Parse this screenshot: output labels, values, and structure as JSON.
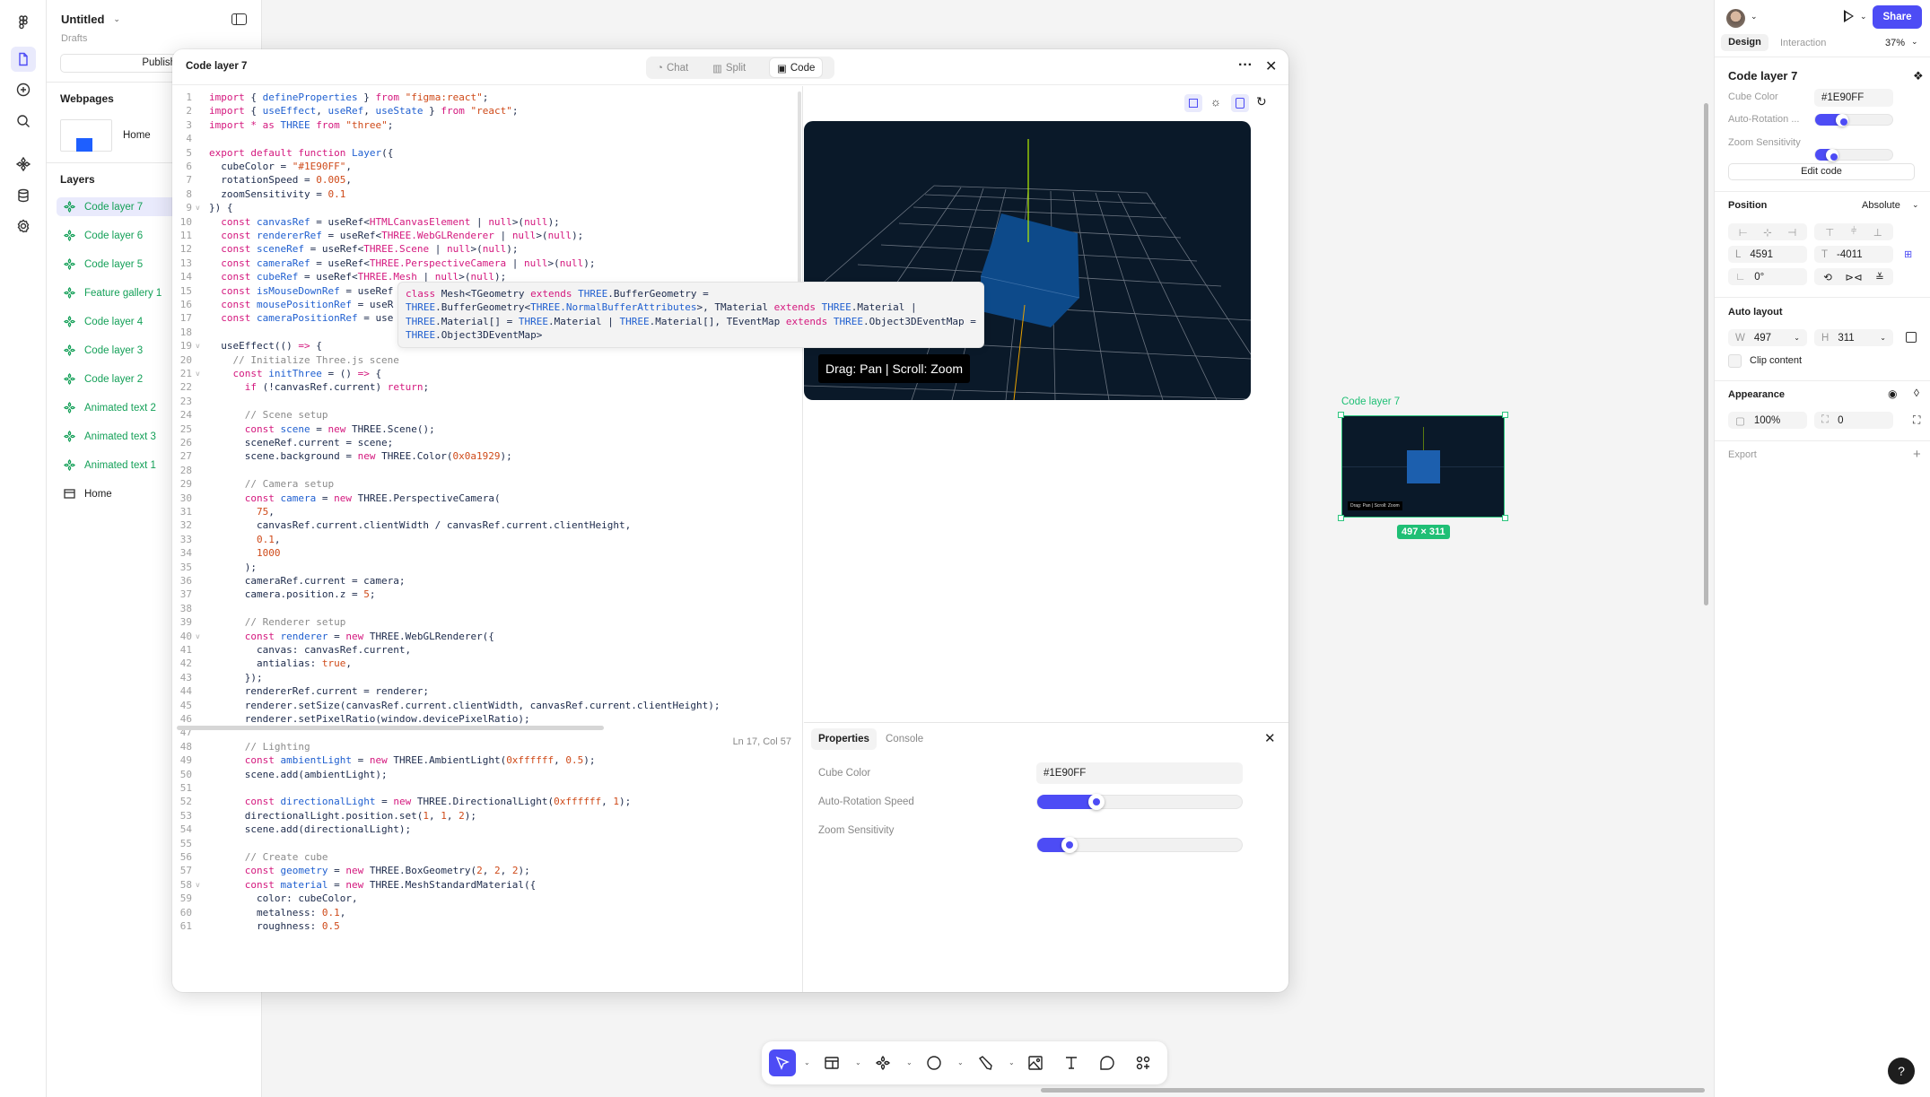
{
  "left_panel": {
    "file_title": "Untitled",
    "location": "Drafts",
    "publish_label": "Publish...",
    "webpages_heading": "Webpages",
    "webpages": [
      {
        "label": "Home"
      }
    ],
    "layers_heading": "Layers",
    "layers": [
      {
        "label": "Code layer 7",
        "selected": true
      },
      {
        "label": "Code layer 6"
      },
      {
        "label": "Code layer 5"
      },
      {
        "label": "Feature gallery 1"
      },
      {
        "label": "Code layer 4"
      },
      {
        "label": "Code layer 3"
      },
      {
        "label": "Code layer 2"
      },
      {
        "label": "Animated text 2"
      },
      {
        "label": "Animated text 3"
      },
      {
        "label": "Animated text 1"
      },
      {
        "label": "Home",
        "type": "page"
      }
    ]
  },
  "modal": {
    "title": "Code layer 7",
    "tabs": [
      {
        "label": "Chat"
      },
      {
        "label": "Split"
      },
      {
        "label": "Code",
        "active": true
      }
    ],
    "status": "Ln 17, Col 57",
    "folded_lines": [
      9,
      19,
      21,
      40,
      58
    ],
    "code_lines": [
      [
        [
          "k",
          "import"
        ],
        [
          "p",
          " { "
        ],
        [
          "v",
          "defineProperties"
        ],
        [
          "p",
          " } "
        ],
        [
          "k",
          "from"
        ],
        [
          "p",
          " "
        ],
        [
          "s",
          "\"figma:react\""
        ],
        [
          "p",
          ";"
        ]
      ],
      [
        [
          "k",
          "import"
        ],
        [
          "p",
          " { "
        ],
        [
          "v",
          "useEffect"
        ],
        [
          "p",
          ", "
        ],
        [
          "v",
          "useRef"
        ],
        [
          "p",
          ", "
        ],
        [
          "v",
          "useState"
        ],
        [
          "p",
          " } "
        ],
        [
          "k",
          "from"
        ],
        [
          "p",
          " "
        ],
        [
          "s",
          "\"react\""
        ],
        [
          "p",
          ";"
        ]
      ],
      [
        [
          "k",
          "import"
        ],
        [
          "p",
          " "
        ],
        [
          "k",
          "*"
        ],
        [
          "p",
          " "
        ],
        [
          "k",
          "as"
        ],
        [
          "p",
          " "
        ],
        [
          "v",
          "THREE"
        ],
        [
          "p",
          " "
        ],
        [
          "k",
          "from"
        ],
        [
          "p",
          " "
        ],
        [
          "s",
          "\"three\""
        ],
        [
          "p",
          ";"
        ]
      ],
      [],
      [
        [
          "k",
          "export default function"
        ],
        [
          "p",
          " "
        ],
        [
          "v",
          "Layer"
        ],
        [
          "p",
          "({"
        ]
      ],
      [
        [
          "p",
          "  cubeColor = "
        ],
        [
          "s",
          "\"#1E90FF\""
        ],
        [
          "p",
          ","
        ]
      ],
      [
        [
          "p",
          "  rotationSpeed = "
        ],
        [
          "n",
          "0.005"
        ],
        [
          "p",
          ","
        ]
      ],
      [
        [
          "p",
          "  zoomSensitivity = "
        ],
        [
          "n",
          "0.1"
        ]
      ],
      [
        [
          "p",
          "}) {"
        ]
      ],
      [
        [
          "p",
          "  "
        ],
        [
          "k",
          "const"
        ],
        [
          "p",
          " "
        ],
        [
          "v",
          "canvasRef"
        ],
        [
          "p",
          " = useRef<"
        ],
        [
          "k",
          "HTMLCanvasElement"
        ],
        [
          "p",
          " | "
        ],
        [
          "k",
          "null"
        ],
        [
          "p",
          ">("
        ],
        [
          "k",
          "null"
        ],
        [
          "p",
          ");"
        ]
      ],
      [
        [
          "p",
          "  "
        ],
        [
          "k",
          "const"
        ],
        [
          "p",
          " "
        ],
        [
          "v",
          "rendererRef"
        ],
        [
          "p",
          " = useRef<"
        ],
        [
          "k",
          "THREE.WebGLRenderer"
        ],
        [
          "p",
          " | "
        ],
        [
          "k",
          "null"
        ],
        [
          "p",
          ">("
        ],
        [
          "k",
          "null"
        ],
        [
          "p",
          ");"
        ]
      ],
      [
        [
          "p",
          "  "
        ],
        [
          "k",
          "const"
        ],
        [
          "p",
          " "
        ],
        [
          "v",
          "sceneRef"
        ],
        [
          "p",
          " = useRef<"
        ],
        [
          "k",
          "THREE.Scene"
        ],
        [
          "p",
          " | "
        ],
        [
          "k",
          "null"
        ],
        [
          "p",
          ">("
        ],
        [
          "k",
          "null"
        ],
        [
          "p",
          ");"
        ]
      ],
      [
        [
          "p",
          "  "
        ],
        [
          "k",
          "const"
        ],
        [
          "p",
          " "
        ],
        [
          "v",
          "cameraRef"
        ],
        [
          "p",
          " = useRef<"
        ],
        [
          "k",
          "THREE.PerspectiveCamera"
        ],
        [
          "p",
          " | "
        ],
        [
          "k",
          "null"
        ],
        [
          "p",
          ">("
        ],
        [
          "k",
          "null"
        ],
        [
          "p",
          ");"
        ]
      ],
      [
        [
          "p",
          "  "
        ],
        [
          "k",
          "const"
        ],
        [
          "p",
          " "
        ],
        [
          "v",
          "cubeRef"
        ],
        [
          "p",
          " = useRef<"
        ],
        [
          "k",
          "THREE.Mesh"
        ],
        [
          "p",
          " | "
        ],
        [
          "k",
          "null"
        ],
        [
          "p",
          ">("
        ],
        [
          "k",
          "null"
        ],
        [
          "p",
          ");"
        ]
      ],
      [
        [
          "p",
          "  "
        ],
        [
          "k",
          "const"
        ],
        [
          "p",
          " "
        ],
        [
          "v",
          "isMouseDownRef"
        ],
        [
          "p",
          " = useRef"
        ]
      ],
      [
        [
          "p",
          "  "
        ],
        [
          "k",
          "const"
        ],
        [
          "p",
          " "
        ],
        [
          "v",
          "mousePositionRef"
        ],
        [
          "p",
          " = useR"
        ]
      ],
      [
        [
          "p",
          "  "
        ],
        [
          "k",
          "const"
        ],
        [
          "p",
          " "
        ],
        [
          "v",
          "cameraPositionRef"
        ],
        [
          "p",
          " = use"
        ]
      ],
      [],
      [
        [
          "p",
          "  useEffect(() "
        ],
        [
          "k",
          "=>"
        ],
        [
          "p",
          " {"
        ]
      ],
      [
        [
          "c",
          "    // Initialize Three.js scene"
        ]
      ],
      [
        [
          "p",
          "    "
        ],
        [
          "k",
          "const"
        ],
        [
          "p",
          " "
        ],
        [
          "v",
          "initThree"
        ],
        [
          "p",
          " = () "
        ],
        [
          "k",
          "=>"
        ],
        [
          "p",
          " {"
        ]
      ],
      [
        [
          "p",
          "      "
        ],
        [
          "k",
          "if"
        ],
        [
          "p",
          " (!canvasRef.current) "
        ],
        [
          "k",
          "return"
        ],
        [
          "p",
          ";"
        ]
      ],
      [],
      [
        [
          "c",
          "      // Scene setup"
        ]
      ],
      [
        [
          "p",
          "      "
        ],
        [
          "k",
          "const"
        ],
        [
          "p",
          " "
        ],
        [
          "v",
          "scene"
        ],
        [
          "p",
          " = "
        ],
        [
          "k",
          "new"
        ],
        [
          "p",
          " THREE.Scene();"
        ]
      ],
      [
        [
          "p",
          "      sceneRef.current = scene;"
        ]
      ],
      [
        [
          "p",
          "      scene.background = "
        ],
        [
          "k",
          "new"
        ],
        [
          "p",
          " THREE.Color("
        ],
        [
          "n",
          "0x0a1929"
        ],
        [
          "p",
          ");"
        ]
      ],
      [],
      [
        [
          "c",
          "      // Camera setup"
        ]
      ],
      [
        [
          "p",
          "      "
        ],
        [
          "k",
          "const"
        ],
        [
          "p",
          " "
        ],
        [
          "v",
          "camera"
        ],
        [
          "p",
          " = "
        ],
        [
          "k",
          "new"
        ],
        [
          "p",
          " THREE.PerspectiveCamera("
        ]
      ],
      [
        [
          "p",
          "        "
        ],
        [
          "n",
          "75"
        ],
        [
          "p",
          ","
        ]
      ],
      [
        [
          "p",
          "        canvasRef.current.clientWidth / canvasRef.current.clientHeight,"
        ]
      ],
      [
        [
          "p",
          "        "
        ],
        [
          "n",
          "0.1"
        ],
        [
          "p",
          ","
        ]
      ],
      [
        [
          "p",
          "        "
        ],
        [
          "n",
          "1000"
        ]
      ],
      [
        [
          "p",
          "      );"
        ]
      ],
      [
        [
          "p",
          "      cameraRef.current = camera;"
        ]
      ],
      [
        [
          "p",
          "      camera.position.z = "
        ],
        [
          "n",
          "5"
        ],
        [
          "p",
          ";"
        ]
      ],
      [],
      [
        [
          "c",
          "      // Renderer setup"
        ]
      ],
      [
        [
          "p",
          "      "
        ],
        [
          "k",
          "const"
        ],
        [
          "p",
          " "
        ],
        [
          "v",
          "renderer"
        ],
        [
          "p",
          " = "
        ],
        [
          "k",
          "new"
        ],
        [
          "p",
          " THREE.WebGLRenderer({"
        ]
      ],
      [
        [
          "p",
          "        canvas: canvasRef.current,"
        ]
      ],
      [
        [
          "p",
          "        antialias: "
        ],
        [
          "n",
          "true"
        ],
        [
          "p",
          ","
        ]
      ],
      [
        [
          "p",
          "      });"
        ]
      ],
      [
        [
          "p",
          "      rendererRef.current = renderer;"
        ]
      ],
      [
        [
          "p",
          "      renderer.setSize(canvasRef.current.clientWidth, canvasRef.current.clientHeight);"
        ]
      ],
      [
        [
          "p",
          "      renderer.setPixelRatio(window.devicePixelRatio);"
        ]
      ],
      [],
      [
        [
          "c",
          "      // Lighting"
        ]
      ],
      [
        [
          "p",
          "      "
        ],
        [
          "k",
          "const"
        ],
        [
          "p",
          " "
        ],
        [
          "v",
          "ambientLight"
        ],
        [
          "p",
          " = "
        ],
        [
          "k",
          "new"
        ],
        [
          "p",
          " THREE.AmbientLight("
        ],
        [
          "n",
          "0xffffff"
        ],
        [
          "p",
          ", "
        ],
        [
          "n",
          "0.5"
        ],
        [
          "p",
          ");"
        ]
      ],
      [
        [
          "p",
          "      scene.add(ambientLight);"
        ]
      ],
      [],
      [
        [
          "p",
          "      "
        ],
        [
          "k",
          "const"
        ],
        [
          "p",
          " "
        ],
        [
          "v",
          "directionalLight"
        ],
        [
          "p",
          " = "
        ],
        [
          "k",
          "new"
        ],
        [
          "p",
          " THREE.DirectionalLight("
        ],
        [
          "n",
          "0xffffff"
        ],
        [
          "p",
          ", "
        ],
        [
          "n",
          "1"
        ],
        [
          "p",
          ");"
        ]
      ],
      [
        [
          "p",
          "      directionalLight.position.set("
        ],
        [
          "n",
          "1"
        ],
        [
          "p",
          ", "
        ],
        [
          "n",
          "1"
        ],
        [
          "p",
          ", "
        ],
        [
          "n",
          "2"
        ],
        [
          "p",
          ");"
        ]
      ],
      [
        [
          "p",
          "      scene.add(directionalLight);"
        ]
      ],
      [],
      [
        [
          "c",
          "      // Create cube"
        ]
      ],
      [
        [
          "p",
          "      "
        ],
        [
          "k",
          "const"
        ],
        [
          "p",
          " "
        ],
        [
          "v",
          "geometry"
        ],
        [
          "p",
          " = "
        ],
        [
          "k",
          "new"
        ],
        [
          "p",
          " THREE.BoxGeometry("
        ],
        [
          "n",
          "2"
        ],
        [
          "p",
          ", "
        ],
        [
          "n",
          "2"
        ],
        [
          "p",
          ", "
        ],
        [
          "n",
          "2"
        ],
        [
          "p",
          ");"
        ]
      ],
      [
        [
          "p",
          "      "
        ],
        [
          "k",
          "const"
        ],
        [
          "p",
          " "
        ],
        [
          "v",
          "material"
        ],
        [
          "p",
          " = "
        ],
        [
          "k",
          "new"
        ],
        [
          "p",
          " THREE.MeshStandardMaterial({"
        ]
      ],
      [
        [
          "p",
          "        color: cubeColor,"
        ]
      ],
      [
        [
          "p",
          "        metalness: "
        ],
        [
          "n",
          "0.1"
        ],
        [
          "p",
          ","
        ]
      ],
      [
        [
          "p",
          "        roughness: "
        ],
        [
          "n",
          "0.5"
        ]
      ]
    ],
    "tooltip_lines": [
      [
        [
          "k",
          "class"
        ],
        [
          "p",
          " Mesh<"
        ],
        [
          "p",
          "TGeometry "
        ],
        [
          "k",
          "extends"
        ],
        [
          "p",
          " "
        ],
        [
          "v",
          "THREE"
        ],
        [
          "p",
          ".BufferGeometry ="
        ]
      ],
      [
        [
          "v",
          "THREE"
        ],
        [
          "p",
          ".BufferGeometry<"
        ],
        [
          "v",
          "THREE.NormalBufferAttributes"
        ],
        [
          "p",
          ">, TMaterial "
        ],
        [
          "k",
          "extends"
        ],
        [
          "p",
          " "
        ],
        [
          "v",
          "THREE"
        ],
        [
          "p",
          ".Material |"
        ]
      ],
      [
        [
          "v",
          "THREE"
        ],
        [
          "p",
          ".Material[] = "
        ],
        [
          "v",
          "THREE"
        ],
        [
          "p",
          ".Material | "
        ],
        [
          "v",
          "THREE"
        ],
        [
          "p",
          ".Material[], TEventMap "
        ],
        [
          "k",
          "extends"
        ],
        [
          "p",
          " "
        ],
        [
          "v",
          "THREE"
        ],
        [
          "p",
          ".Object3DEventMap ="
        ]
      ],
      [
        [
          "v",
          "THREE"
        ],
        [
          "p",
          ".Object3DEventMap>"
        ]
      ]
    ],
    "preview_hint": "Drag: Pan | Scroll: Zoom",
    "properties": {
      "tabs": [
        {
          "label": "Properties",
          "active": true
        },
        {
          "label": "Console"
        }
      ],
      "cube_color_label": "Cube Color",
      "cube_color_value": "#1E90FF",
      "rotation_label": "Auto-Rotation Speed",
      "rotation_fraction": 0.27,
      "zoom_label": "Zoom Sensitivity",
      "zoom_fraction": 0.14
    }
  },
  "canvas": {
    "frame_label": "Code layer 7",
    "frame_hint": "Drag: Pan | Scroll: Zoom",
    "size_badge": "497 × 311",
    "help_label": "?"
  },
  "right_panel": {
    "share_label": "Share",
    "tabs": [
      {
        "label": "Design",
        "active": true
      },
      {
        "label": "Interaction"
      }
    ],
    "zoom": "37%",
    "layer_title": "Code layer 7",
    "cube_color_label": "Cube Color",
    "cube_color_value": "#1E90FF",
    "rotation_label": "Auto-Rotation ...",
    "rotation_fraction": 0.3,
    "zoom_label": "Zoom Sensitivity",
    "zoom_fraction": 0.18,
    "edit_code_label": "Edit code",
    "position_heading": "Position",
    "position_mode": "Absolute",
    "l_label": "L",
    "l_value": "4591",
    "t_label": "T",
    "t_value": "-4011",
    "rotation_value": "0°",
    "auto_layout_heading": "Auto layout",
    "w_label": "W",
    "w_value": "497",
    "h_label": "H",
    "h_value": "311",
    "clip_label": "Clip content",
    "appearance_heading": "Appearance",
    "opacity": "100%",
    "radius": "0",
    "export_heading": "Export"
  },
  "colors": {
    "accent": "#4d4cf5",
    "layer_green": "#14a058",
    "scene_bg": "#0a1929",
    "cube": "#1E90FF"
  }
}
